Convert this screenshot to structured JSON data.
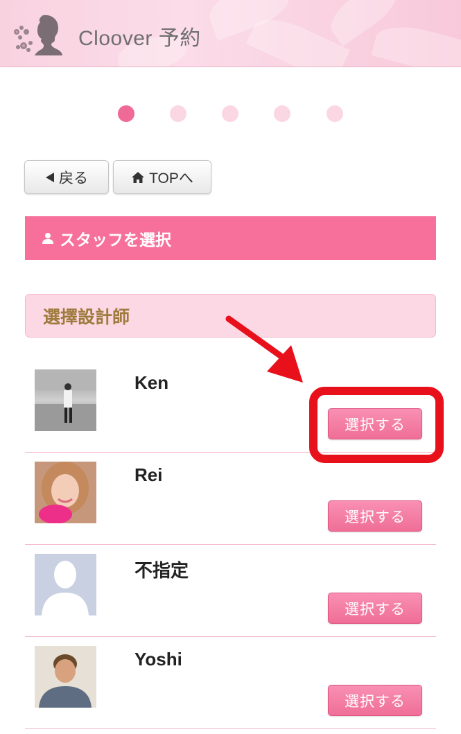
{
  "header": {
    "brand": "Cloover 予約"
  },
  "steps": {
    "count": 5,
    "active_index": 0
  },
  "nav": {
    "back_label": "戻る",
    "top_label": "TOPへ"
  },
  "staff_bar": {
    "label": "スタッフを選択"
  },
  "section": {
    "title": "選擇設計師"
  },
  "staff": [
    {
      "name": "Ken",
      "select_label": "選択する"
    },
    {
      "name": "Rei",
      "select_label": "選択する"
    },
    {
      "name": "不指定",
      "select_label": "選択する"
    },
    {
      "name": "Yoshi",
      "select_label": "選択する"
    }
  ],
  "colors": {
    "accent": "#f7709c",
    "dot_active": "#f06a98",
    "dot_inactive": "#fbd7e4",
    "section_bg": "#fcd8e5",
    "section_text": "#9e7a3c",
    "annotation": "#e8101a"
  },
  "icons": [
    "silhouette-logo-icon",
    "back-triangle-icon",
    "home-icon",
    "user-icon",
    "arrow-annotation-icon"
  ]
}
